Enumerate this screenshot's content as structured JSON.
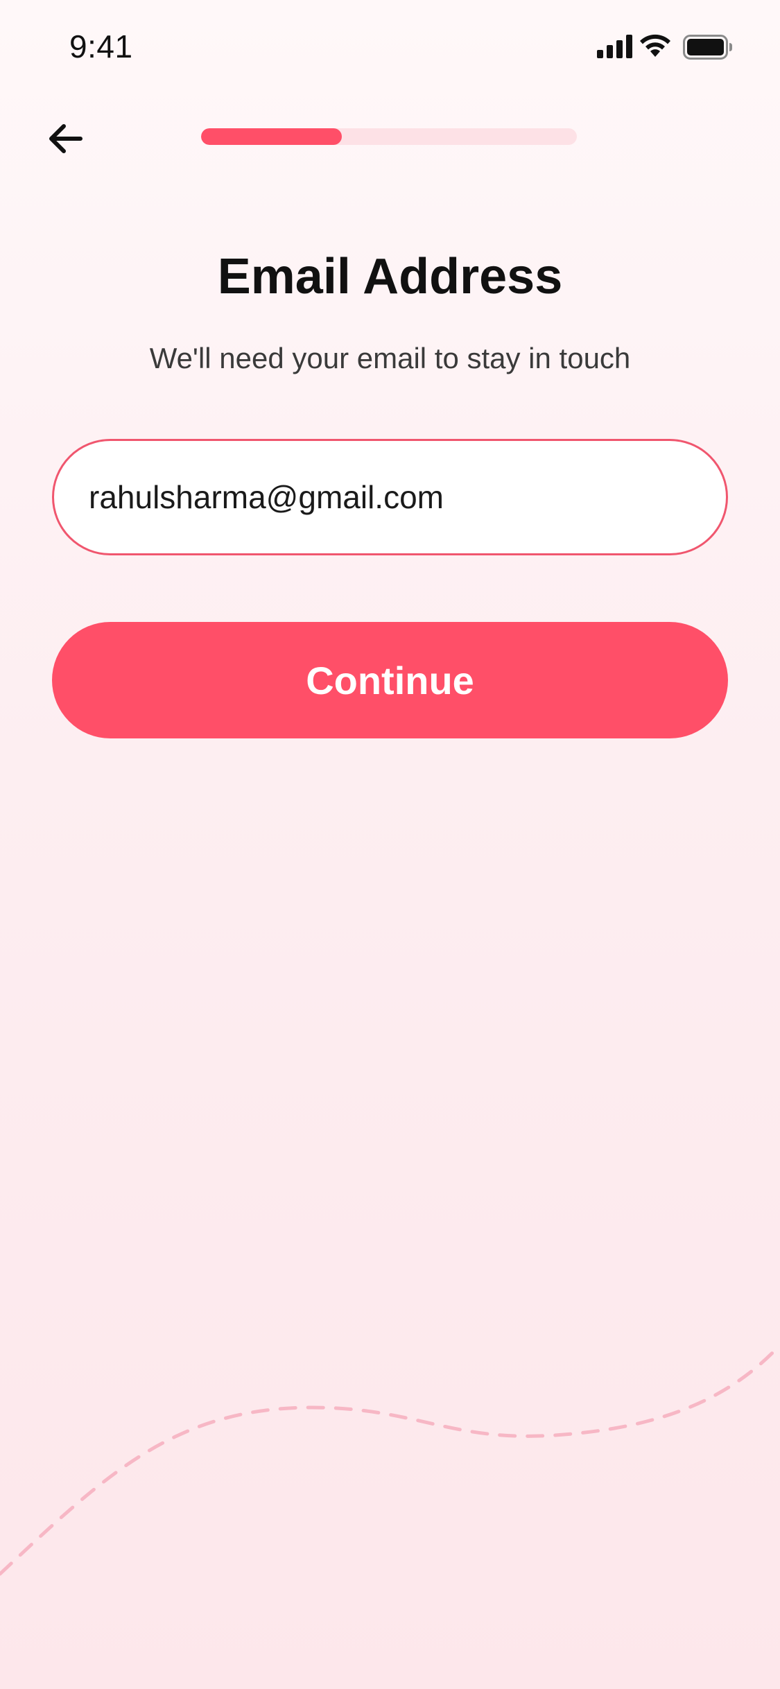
{
  "status_bar": {
    "time": "9:41",
    "icons": [
      "signal-icon",
      "wifi-icon",
      "battery-icon"
    ]
  },
  "navigation": {
    "back_icon": "arrow-left-icon",
    "progress": 0.375
  },
  "header": {
    "title": "Email Address",
    "subtitle": "We'll need your email to stay in touch"
  },
  "form": {
    "email_value": "rahulsharma@gmail.com",
    "continue_label": "Continue"
  },
  "colors": {
    "accent": "#ff4f68",
    "progress_track": "#fde1e6",
    "input_border": "#f0566e",
    "background_top": "#fff8f9",
    "background_bottom": "#fde7eb",
    "wave": "#f7b7c5"
  }
}
